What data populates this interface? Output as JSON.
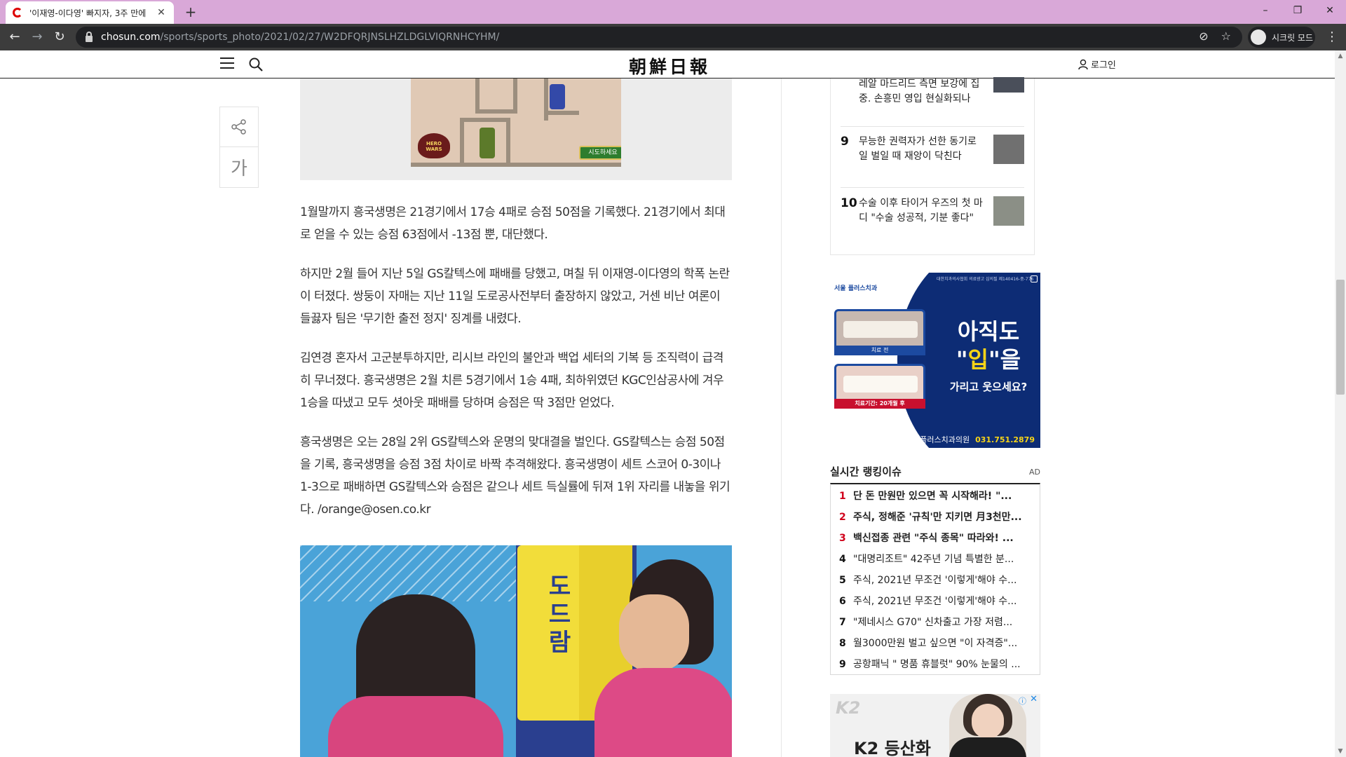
{
  "browser": {
    "tab_title": "'이재영-이다영' 빠지자, 3주 만에",
    "new_tab": "+",
    "url_host": "chosun.com",
    "url_path": "/sports/sports_photo/2021/02/27/W2DFQRJNSLHZLDGLVIQRNHCYHM/",
    "incognito_label": "시크릿 모드",
    "colors": {
      "tabbar": "#d9a8d8",
      "toolbar": "#3c3c3c"
    },
    "icons": [
      "back-icon",
      "forward-icon",
      "reload-icon",
      "lock-icon",
      "eye-off-icon",
      "star-icon",
      "menu-kebab-icon"
    ]
  },
  "header": {
    "logo": "朝鮮日報",
    "login": "로그인"
  },
  "share": {
    "font_label": "가"
  },
  "ad_game": {
    "cta": "시도하세요",
    "brand": "HERO WARS"
  },
  "article": {
    "paragraphs": [
      "1월말까지 흥국생명은 21경기에서 17승 4패로 승점 50점을 기록했다. 21경기에서 최대로 얻을 수 있는 승점 63점에서 -13점 뿐, 대단했다.",
      "하지만 2월 들어 지난 5일 GS칼텍스에 패배를 당했고, 며칠 뒤 이재영-이다영의 학폭 논란이 터졌다. 쌍둥이 자매는 지난 11일 도로공사전부터 출장하지 않았고, 거센 비난 여론이 들끓자 팀은 '무기한 출전 정지' 징계를 내렸다.",
      "김연경 혼자서 고군분투하지만, 리시브 라인의 불안과 백업 세터의 기복 등 조직력이 급격히 무너졌다. 흥국생명은 2월 치른 5경기에서 1승 4패, 최하위였던 KGC인삼공사에 겨우 1승을 따냈고 모두 셧아웃 패배를 당하며 승점은 딱 3점만 얻었다.",
      "흥국생명은 오는 28일 2위 GS칼텍스와 운명의 맞대결을 벌인다. GS칼텍스는 승점 50점을 기록, 흥국생명을 승점 3점 차이로 바짝 추격해왔다. 흥국생명이 세트 스코어 0-3이나 1-3으로 패배하면 GS칼텍스와 승점은 같으나 세트 득실률에 뒤져 1위 자리를 내놓을 위기다. /orange@osen.co.kr"
    ]
  },
  "photo": {
    "pad_text": "도드람"
  },
  "sidebar_news": {
    "items": [
      {
        "num": "",
        "text": "레알 마드리드 측면 보강에 집중. 손흥민 영입 현실화되나"
      },
      {
        "num": "9",
        "text": "무능한 권력자가 선한 동기로 일 벌일 때 재앙이 닥친다"
      },
      {
        "num": "10",
        "text": "수술 이후 타이거 우즈의 첫 마디 \"수술 성공적, 기분 좋다\""
      }
    ]
  },
  "ad_dental": {
    "clinic_short": "서울 플러스치과",
    "before_label": "치료 전",
    "after_label": "치료기간: 20개월 후",
    "headline1": "아직도",
    "headline2_a": "\"",
    "headline2_b": "입",
    "headline2_c": "\"을",
    "headline3": "가리고 웃으세요?",
    "clinic_name": "서울플러스치과의원",
    "phone": "031.751.2879",
    "fine_print": "대한치과의사협회 의료광고 심의필 제140416-중-776"
  },
  "ranking": {
    "title": "실시간 랭킹이슈",
    "ad_label": "AD",
    "items": [
      {
        "num": "1",
        "text": "단 돈 만원만 있으면 꼭 시작해라! \"...",
        "hot": true
      },
      {
        "num": "2",
        "text": "주식, 정해준 '규칙'만 지키면 月3천만...",
        "hot": true
      },
      {
        "num": "3",
        "text": "백신접종 관련 \"주식 종목\" 따라와! ...",
        "hot": true
      },
      {
        "num": "4",
        "text": "\"대명리조트\" 42주년 기념 특별한 분...",
        "hot": false
      },
      {
        "num": "5",
        "text": "주식, 2021년 무조건 '이렇게'해야 수...",
        "hot": false
      },
      {
        "num": "6",
        "text": "주식, 2021년 무조건 '이렇게'해야 수...",
        "hot": false
      },
      {
        "num": "7",
        "text": "\"제네시스 G70\" 신차출고 가장 저렴...",
        "hot": false
      },
      {
        "num": "8",
        "text": "월3000만원 벌고 싶으면 \"이 자격증\"...",
        "hot": false
      },
      {
        "num": "9",
        "text": "공항패닉 \" 명품 휴블럿\" 90% 눈물의 ...",
        "hot": false
      }
    ],
    "colors": {
      "hot": "#d0021b"
    }
  },
  "ad_k2": {
    "logo": "K2",
    "text": "K2 등산화"
  }
}
